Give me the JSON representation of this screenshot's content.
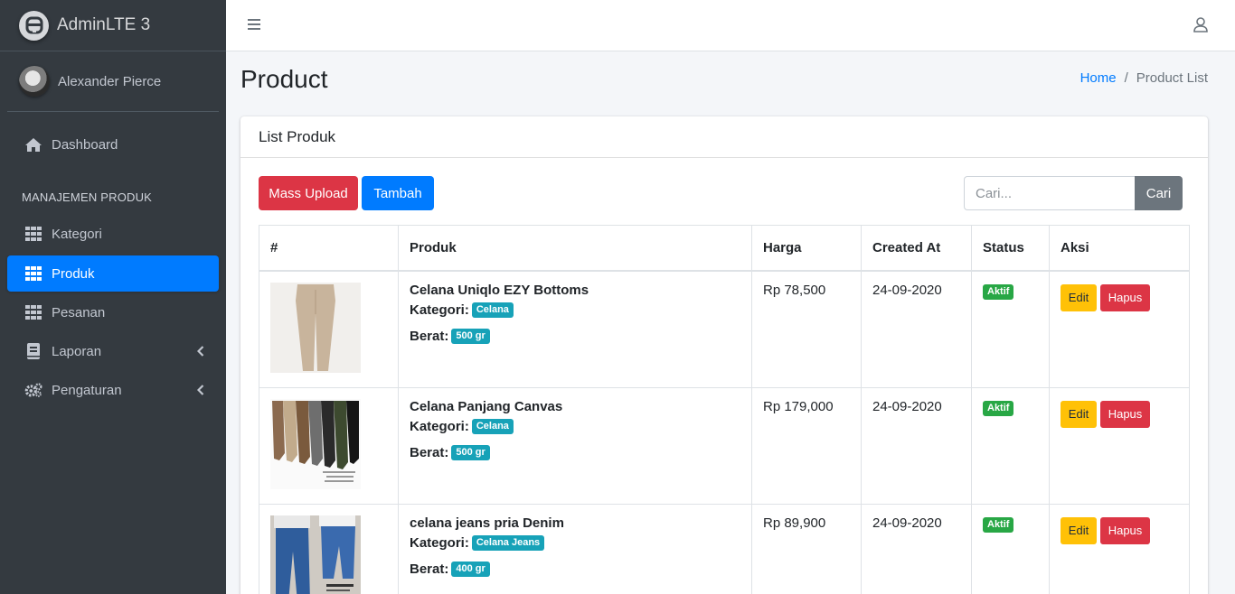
{
  "brand": {
    "name": "AdminLTE 3"
  },
  "user": {
    "name": "Alexander Pierce"
  },
  "sidebar": {
    "dashboard": "Dashboard",
    "section_header": "MANAJEMEN PRODUK",
    "items": [
      {
        "label": "Kategori"
      },
      {
        "label": "Produk"
      },
      {
        "label": "Pesanan"
      },
      {
        "label": "Laporan"
      },
      {
        "label": "Pengaturan"
      }
    ]
  },
  "page": {
    "title": "Product"
  },
  "breadcrumb": {
    "home": "Home",
    "sep": "/",
    "current": "Product List"
  },
  "card": {
    "title": "List Produk"
  },
  "toolbar": {
    "mass_upload": "Mass Upload",
    "tambah": "Tambah",
    "search_placeholder": "Cari...",
    "search_button": "Cari"
  },
  "table": {
    "headers": [
      "#",
      "Produk",
      "Harga",
      "Created At",
      "Status",
      "Aksi"
    ],
    "kategori_label": "Kategori:",
    "berat_label": "Berat:",
    "edit_label": "Edit",
    "hapus_label": "Hapus",
    "rows": [
      {
        "name": "Celana Uniqlo EZY Bottoms",
        "kategori": "Celana",
        "berat": "500 gr",
        "harga": "Rp 78,500",
        "created_at": "24-09-2020",
        "status": "Aktif"
      },
      {
        "name": "Celana Panjang Canvas",
        "kategori": "Celana",
        "berat": "500 gr",
        "harga": "Rp 179,000",
        "created_at": "24-09-2020",
        "status": "Aktif"
      },
      {
        "name": "celana jeans pria Denim",
        "kategori": "Celana Jeans",
        "berat": "400 gr",
        "harga": "Rp 89,900",
        "created_at": "24-09-2020",
        "status": "Aktif"
      }
    ]
  },
  "colors": {
    "primary": "#007bff",
    "danger": "#dc3545",
    "warning": "#ffc107",
    "success": "#28a745",
    "info": "#17a2b8",
    "sidebar_bg": "#343a40"
  }
}
